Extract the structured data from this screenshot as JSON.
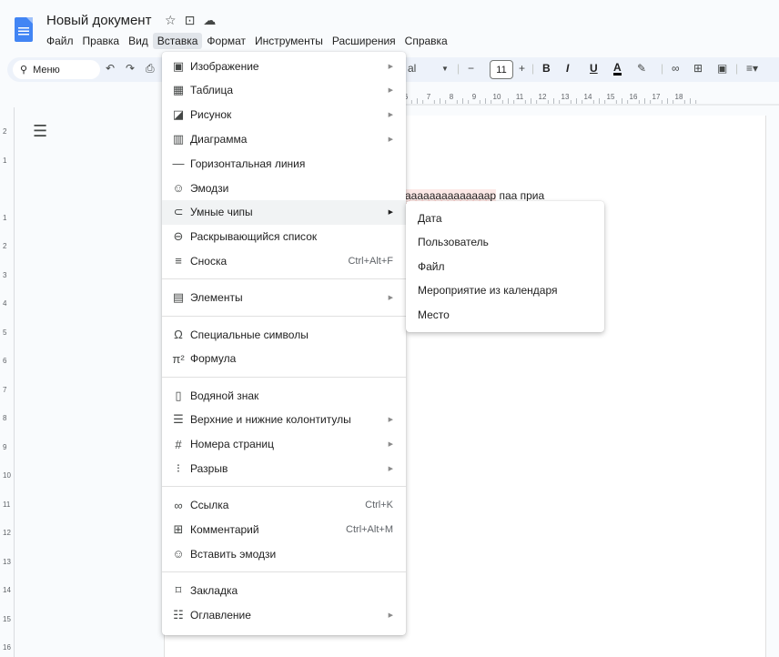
{
  "app": {
    "title": "Новый документ",
    "title_icons": [
      "star-icon",
      "folder-move-icon",
      "cloud-status-icon"
    ]
  },
  "menubar": [
    {
      "label": "Файл",
      "active": false
    },
    {
      "label": "Правка",
      "active": false
    },
    {
      "label": "Вид",
      "active": false
    },
    {
      "label": "Вставка",
      "active": true
    },
    {
      "label": "Формат",
      "active": false
    },
    {
      "label": "Инструменты",
      "active": false
    },
    {
      "label": "Расширения",
      "active": false
    },
    {
      "label": "Справка",
      "active": false
    }
  ],
  "toolbar": {
    "search_label": "Меню",
    "font_name_partial": "al",
    "font_size": "11",
    "bold": "B",
    "italic": "I",
    "underline": "U",
    "text_color": "A"
  },
  "ruler": {
    "top_ticks": [
      "6",
      "7",
      "8",
      "9",
      "10",
      "11",
      "12",
      "13",
      "14",
      "15",
      "16",
      "17",
      "18"
    ],
    "left_ticks": [
      "2",
      "1",
      "",
      "1",
      "2",
      "3",
      "4",
      "5",
      "6",
      "7",
      "8",
      "9",
      "10",
      "11",
      "12",
      "13",
      "14",
      "15",
      "16"
    ]
  },
  "document": {
    "text_error": "аааааааааааааар",
    "text_rest": " паа приа"
  },
  "insert_menu": {
    "groups": [
      [
        {
          "icon": "image-icon",
          "glyph": "▣",
          "label": "Изображение",
          "submenu": true
        },
        {
          "icon": "table-icon",
          "glyph": "▦",
          "label": "Таблица",
          "submenu": true
        },
        {
          "icon": "drawing-icon",
          "glyph": "◪",
          "label": "Рисунок",
          "submenu": true
        },
        {
          "icon": "chart-icon",
          "glyph": "▥",
          "label": "Диаграмма",
          "submenu": true
        },
        {
          "icon": "horizontal-line-icon",
          "glyph": "—",
          "label": "Горизонтальная линия",
          "submenu": false
        },
        {
          "icon": "emoji-icon",
          "glyph": "☺",
          "label": "Эмодзи",
          "submenu": false
        },
        {
          "icon": "smart-chips-icon",
          "glyph": "⊂",
          "label": "Умные чипы",
          "submenu": true,
          "highlighted": true
        },
        {
          "icon": "dropdown-icon",
          "glyph": "⊖",
          "label": "Раскрывающийся список",
          "submenu": false
        },
        {
          "icon": "footnote-icon",
          "glyph": "≡",
          "label": "Сноска",
          "submenu": false,
          "shortcut": "Ctrl+Alt+F"
        }
      ],
      [
        {
          "icon": "building-blocks-icon",
          "glyph": "▤",
          "label": "Элементы",
          "submenu": true
        }
      ],
      [
        {
          "icon": "omega-icon",
          "glyph": "Ω",
          "label": "Специальные символы",
          "submenu": false
        },
        {
          "icon": "pi-icon",
          "glyph": "π²",
          "label": "Формула",
          "submenu": false
        }
      ],
      [
        {
          "icon": "watermark-icon",
          "glyph": "▯",
          "label": "Водяной знак",
          "submenu": false
        },
        {
          "icon": "header-footer-icon",
          "glyph": "☰",
          "label": "Верхние и нижние колонтитулы",
          "submenu": true
        },
        {
          "icon": "hash-icon",
          "glyph": "#",
          "label": "Номера страниц",
          "submenu": true
        },
        {
          "icon": "break-icon",
          "glyph": "⁝",
          "label": "Разрыв",
          "submenu": true
        }
      ],
      [
        {
          "icon": "link-icon",
          "glyph": "∞",
          "label": "Ссылка",
          "submenu": false,
          "shortcut": "Ctrl+K"
        },
        {
          "icon": "comment-icon",
          "glyph": "⊞",
          "label": "Комментарий",
          "submenu": false,
          "shortcut": "Ctrl+Alt+M"
        },
        {
          "icon": "insert-emoji-icon",
          "glyph": "☺",
          "label": "Вставить эмодзи",
          "submenu": false
        }
      ],
      [
        {
          "icon": "bookmark-icon",
          "glyph": "⌑",
          "label": "Закладка",
          "submenu": false
        },
        {
          "icon": "table-of-contents-icon",
          "glyph": "☷",
          "label": "Оглавление",
          "submenu": true
        }
      ]
    ]
  },
  "smart_chips_submenu": {
    "items": [
      "Дата",
      "Пользователь",
      "Файл",
      "Мероприятие из календаря",
      "Место"
    ]
  }
}
